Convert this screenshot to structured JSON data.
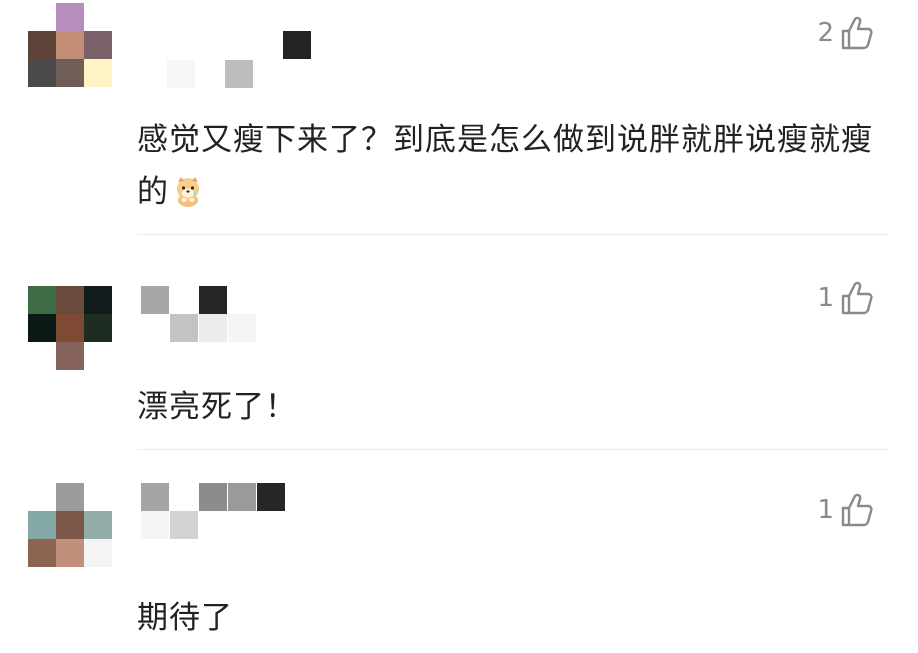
{
  "comments": [
    {
      "likes": "2",
      "text": "感觉又瘦下来了？到底是怎么做到说胖就胖说瘦就瘦的",
      "emoji": "shy-dog-emoji",
      "avatar_pixels": [
        [
          "",
          "#b68dbd",
          ""
        ],
        [
          "#5e4338",
          "#c28d74",
          "#7a6069"
        ],
        [
          "#4d4a4b",
          "#6e5e56",
          "#fff4c6"
        ]
      ]
    },
    {
      "likes": "1",
      "text": "漂亮死了！",
      "avatar_pixels": [
        [
          "#3d6b45",
          "#6b4a3e",
          "#111b1c"
        ],
        [
          "#0c1a17",
          "#7e4a34",
          "#1d2d22"
        ],
        [
          "",
          "#85625b",
          ""
        ]
      ]
    },
    {
      "likes": "1",
      "text": "期待了",
      "avatar_pixels": [
        [
          "",
          "#9c9c9c",
          ""
        ],
        [
          "#85a9a5",
          "#7d5747",
          "#93aea9"
        ],
        [
          "#8c6452",
          "#c18f7b",
          "#f4f4f4"
        ]
      ]
    }
  ],
  "colors": {
    "text": "#222222",
    "like_count": "#8a8a8a",
    "divider": "#ececec"
  }
}
